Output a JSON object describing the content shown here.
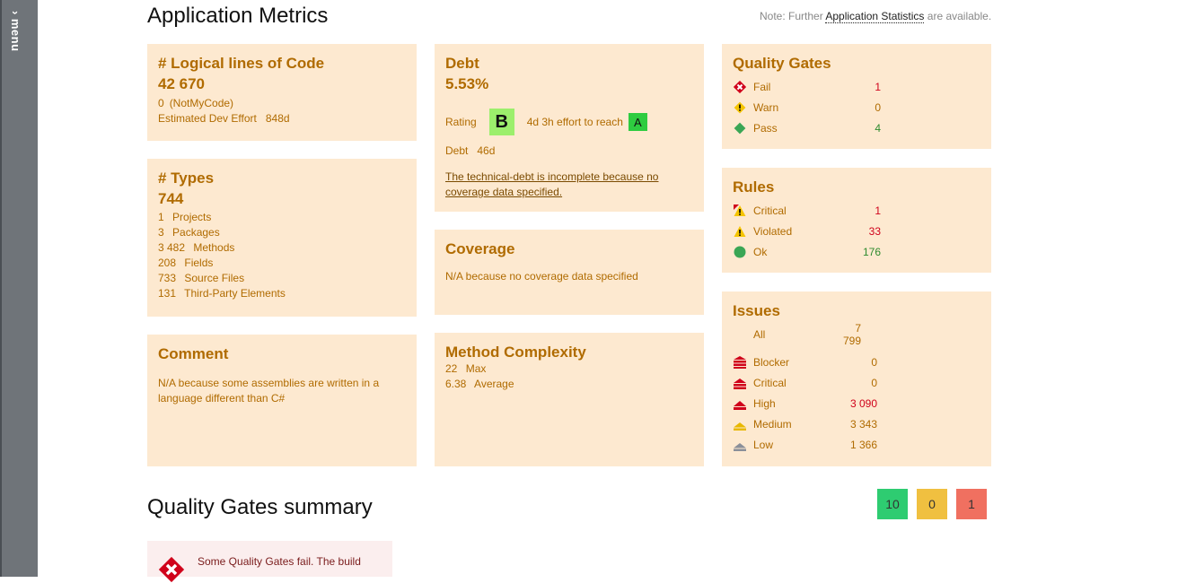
{
  "sidebar": {
    "label": "menu",
    "chevron": "›"
  },
  "header": {
    "title": "Application Metrics",
    "note_prefix": "Note: Further ",
    "note_link": "Application Statistics",
    "note_suffix": " are available."
  },
  "loc": {
    "title": "# Logical lines of Code",
    "value": "42 670",
    "notmycode_value": "0",
    "notmycode_label": "(NotMyCode)",
    "effort_label": "Estimated Dev Effort",
    "effort_value": "848d"
  },
  "types": {
    "title": "# Types",
    "value": "744",
    "items": [
      {
        "value": "1",
        "label": "Projects"
      },
      {
        "value": "3",
        "label": "Packages"
      },
      {
        "value": "3 482",
        "label": "Methods"
      },
      {
        "value": "208",
        "label": "Fields"
      },
      {
        "value": "733",
        "label": "Source Files"
      },
      {
        "value": "131",
        "label": "Third-Party Elements"
      }
    ]
  },
  "comment": {
    "title": "Comment",
    "text": "N/A because some assemblies are written in a language different than C#"
  },
  "debt": {
    "title": "Debt",
    "value": "5.53%",
    "rating_label": "Rating",
    "rating": "B",
    "effort_text": "4d 3h effort to reach",
    "target_rating": "A",
    "debt_label": "Debt",
    "debt_value": "46d",
    "link_text": "The technical-debt is incomplete because no coverage data specified."
  },
  "coverage": {
    "title": "Coverage",
    "text": "N/A because no coverage data specified"
  },
  "complexity": {
    "title": "Method Complexity",
    "items": [
      {
        "value": "22",
        "label": "Max"
      },
      {
        "value": "6.38",
        "label": "Average"
      }
    ]
  },
  "quality_gates": {
    "title": "Quality Gates",
    "items": [
      {
        "label": "Fail",
        "value": "1",
        "icon": "fail-icon",
        "color": "#d0021b"
      },
      {
        "label": "Warn",
        "value": "0",
        "icon": "warn-icon",
        "color": "#b06b00"
      },
      {
        "label": "Pass",
        "value": "4",
        "icon": "pass-icon",
        "color": "#2e8b2e"
      }
    ]
  },
  "rules": {
    "title": "Rules",
    "items": [
      {
        "label": "Critical",
        "value": "1",
        "icon": "critical-warning-icon",
        "color": "#d0021b"
      },
      {
        "label": "Violated",
        "value": "33",
        "icon": "warning-icon",
        "color": "#d0021b"
      },
      {
        "label": "Ok",
        "value": "176",
        "icon": "ok-circle-icon",
        "color": "#2e8b2e"
      }
    ]
  },
  "issues": {
    "title": "Issues",
    "all_label": "All",
    "all_value": "7 799",
    "items": [
      {
        "label": "Blocker",
        "value": "0",
        "icon": "blocker-icon",
        "color": "#b06b00"
      },
      {
        "label": "Critical",
        "value": "0",
        "icon": "critical-icon",
        "color": "#b06b00"
      },
      {
        "label": "High",
        "value": "3 090",
        "icon": "high-icon",
        "color": "#d0021b"
      },
      {
        "label": "Medium",
        "value": "3 343",
        "icon": "medium-icon",
        "color": "#b06b00"
      },
      {
        "label": "Low",
        "value": "1 366",
        "icon": "low-icon",
        "color": "#b06b00"
      }
    ]
  },
  "summary": {
    "title": "Quality Gates summary",
    "pass_count": "10",
    "warn_count": "0",
    "fail_count": "1",
    "message": "Some Quality Gates fail. The build"
  },
  "colors": {
    "card_bg": "#fde9d0",
    "accent": "#b06b00",
    "pass": "#2ecc71",
    "warn": "#f0c040",
    "fail": "#f07060",
    "rating_b": "#9cef6c",
    "rating_a": "#2ecc40"
  }
}
